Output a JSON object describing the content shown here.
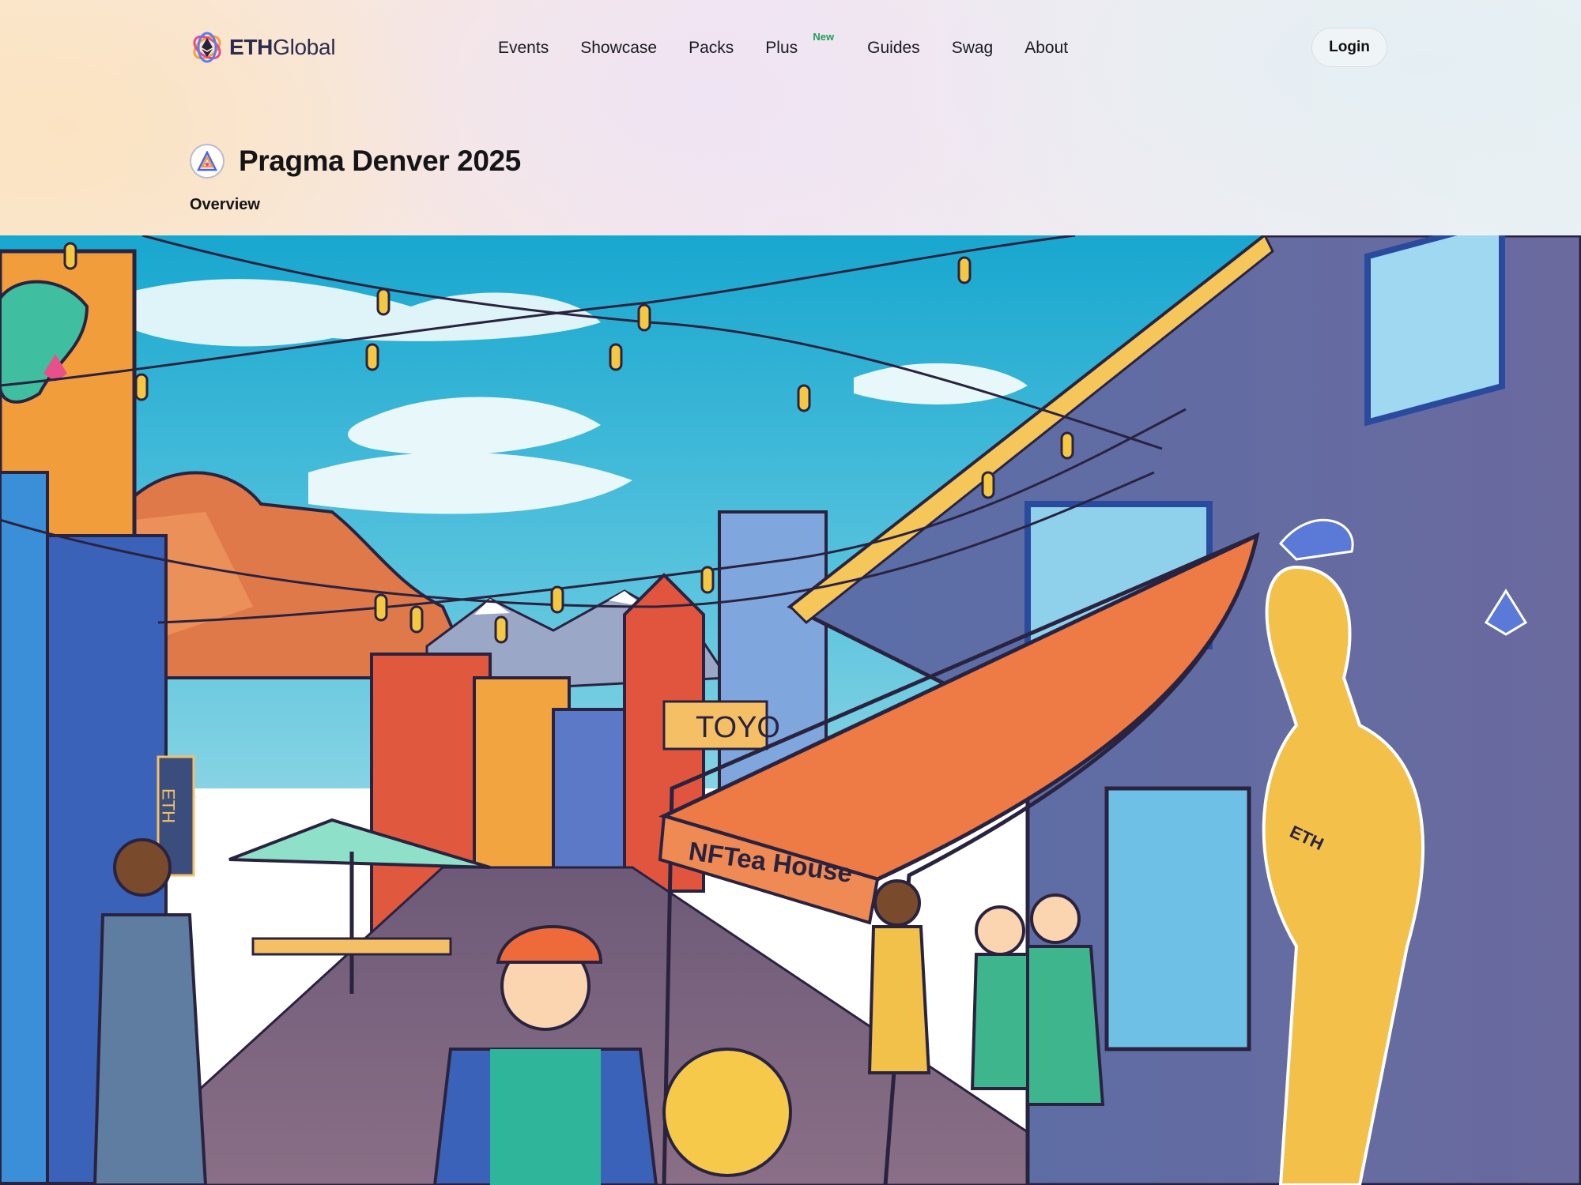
{
  "header": {
    "logo": {
      "text_bold": "ETH",
      "text_light": "Global"
    },
    "nav": [
      {
        "label": "Events"
      },
      {
        "label": "Showcase"
      },
      {
        "label": "Packs"
      },
      {
        "label": "Plus",
        "badge": "New"
      },
      {
        "label": "Guides"
      },
      {
        "label": "Swag"
      },
      {
        "label": "About"
      }
    ],
    "login_label": "Login"
  },
  "event": {
    "title": "Pragma Denver 2025",
    "tabs": [
      {
        "label": "Overview"
      }
    ]
  },
  "banner": {
    "awning_sign": "NFTea House",
    "vertical_sign": "ETH",
    "shop_sign": "TOYO",
    "sleeve_text": "ETH"
  },
  "colors": {
    "badge_green": "#1f9d55",
    "sky": "#3fb8d8",
    "awning": "#ee7a45"
  }
}
